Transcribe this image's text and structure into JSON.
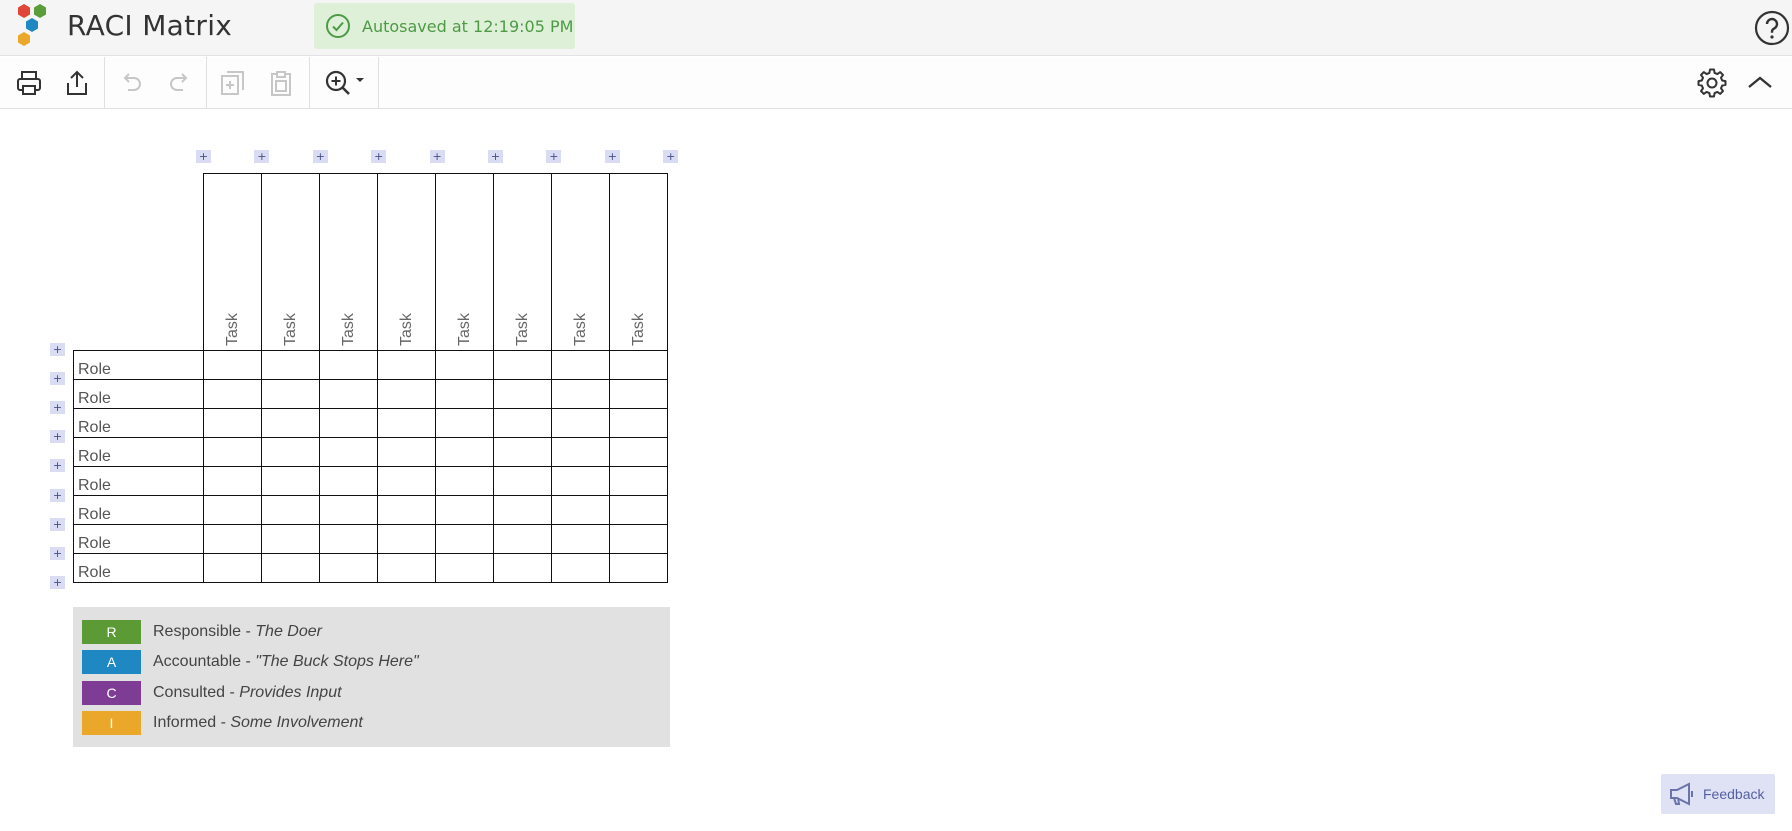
{
  "header": {
    "app_title": "RACI Matrix",
    "autosave_text": "Autosaved at 12:19:05 PM",
    "logo_colors": [
      "#e0463a",
      "#5a9e3a",
      "#1f88c2",
      "#eba72a"
    ]
  },
  "toolbar": {
    "buttons": [
      "print-icon",
      "export-icon",
      "undo-icon",
      "redo-icon",
      "duplicate-icon",
      "paste-icon",
      "zoom-icon",
      "settings-icon",
      "collapse-icon"
    ]
  },
  "matrix": {
    "tasks": [
      "Task",
      "Task",
      "Task",
      "Task",
      "Task",
      "Task",
      "Task",
      "Task"
    ],
    "roles": [
      "Role",
      "Role",
      "Role",
      "Role",
      "Role",
      "Role",
      "Role",
      "Role"
    ],
    "add_symbol": "+"
  },
  "legend": [
    {
      "letter": "R",
      "name": "Responsible - ",
      "desc": "The Doer",
      "color": "#5b9a35"
    },
    {
      "letter": "A",
      "name": "Accountable - ",
      "desc": "\"The Buck Stops Here\"",
      "color": "#1f88c2"
    },
    {
      "letter": "C",
      "name": "Consulted - ",
      "desc": "Provides Input",
      "color": "#7f3c94"
    },
    {
      "letter": "I",
      "name": "Informed - ",
      "desc": "Some Involvement",
      "color": "#eba72a"
    }
  ],
  "feedback": {
    "label": "Feedback"
  }
}
